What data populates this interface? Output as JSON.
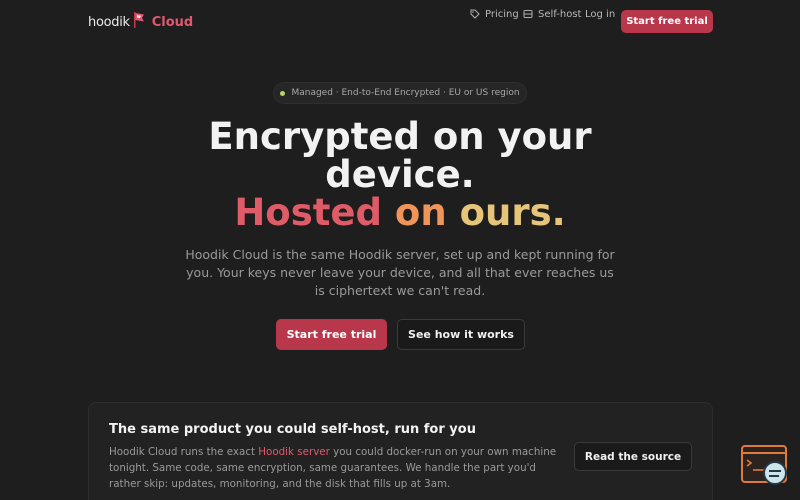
{
  "header": {
    "brand_word": "hoodik",
    "brand_product": "Cloud",
    "nav": [
      {
        "label": "Pricing",
        "icon": "tag-icon"
      },
      {
        "label": "Self-host",
        "icon": "server-icon"
      },
      {
        "label": "Log in"
      }
    ],
    "cta_label": "Start free trial"
  },
  "hero": {
    "pill_text": "Managed · End-to-End Encrypted · EU or US region",
    "title_line1": "Encrypted on your",
    "title_line2": "device.",
    "title_hosted": "Hosted",
    "title_on": "on",
    "title_ours": "ours.",
    "subtitle": "Hoodik Cloud is the same Hoodik server, set up and kept running for you. Your keys never leave your device, and all that ever reaches us is ciphertext we can't read.",
    "primary_label": "Start free trial",
    "secondary_label": "See how it works"
  },
  "card": {
    "title": "The same product you could self-host, run for you",
    "body_before": "Hoodik Cloud runs the exact ",
    "body_link": "Hoodik server",
    "body_after": " you could docker-run on your own machine tonight. Same code, same encryption, same guarantees. We handle the part you'd rather skip: updates, monitoring, and the disk that fills up at 3am.",
    "button_label": "Read the source"
  },
  "colors": {
    "accent": "#b8374a",
    "brand_pink": "#e0586f",
    "gradient_orange": "#f0955a",
    "gradient_gold": "#e6c57a",
    "status_dot": "#b6d56a"
  }
}
